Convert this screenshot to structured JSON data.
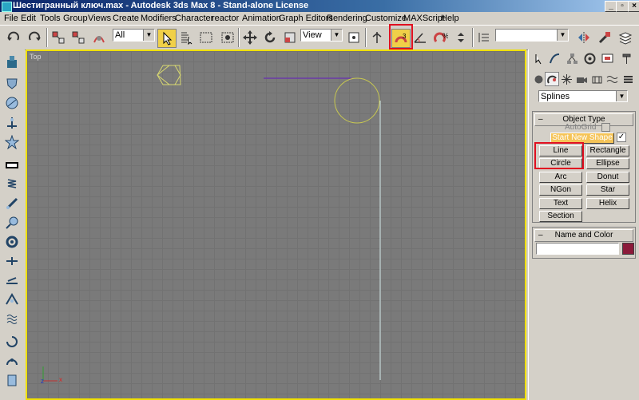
{
  "window": {
    "title": "Шестигранный ключ.max - Autodesk 3ds Max 8  - Stand-alone License",
    "min": "_",
    "max": "▫",
    "close": "×"
  },
  "menu": [
    "File",
    "Edit",
    "Tools",
    "Group",
    "Views",
    "Create",
    "Modifiers",
    "Character",
    "reactor",
    "Animation",
    "Graph Editors",
    "Rendering",
    "Customize",
    "MAXScript",
    "Help"
  ],
  "toolbar": {
    "selection_filter": "All",
    "reference_coord": "View",
    "named_selection": ""
  },
  "viewport": {
    "label": "Top",
    "axis_x": "x",
    "axis_z": "z"
  },
  "command_panel": {
    "category_dropdown": "Splines",
    "object_type": {
      "title": "Object Type",
      "autogrid_label": "AutoGrid",
      "start_new_shape_label": "Start New Shape",
      "buttons": [
        "Line",
        "Rectangle",
        "Circle",
        "Ellipse",
        "Arc",
        "Donut",
        "NGon",
        "Star",
        "Text",
        "Helix",
        "Section"
      ]
    },
    "name_and_color": {
      "title": "Name and Color",
      "name_value": "",
      "color": "#8b1a3a"
    }
  },
  "colors": {
    "viewport_border": "#f0e000",
    "highlight_red": "#e01020",
    "hexagon": "#d8d870",
    "circle": "#c8c850",
    "line_top": "#6a3aa8",
    "line_vertical": "#d8f0f0"
  },
  "icons": [
    "undo-icon",
    "redo-icon",
    "link-icon",
    "unlink-icon",
    "bind-space-warp-icon",
    "select-object-icon",
    "select-by-name-icon",
    "rectangular-selection-icon",
    "window-crossing-icon",
    "move-icon",
    "rotate-icon",
    "scale-icon",
    "pivot-icon",
    "manipulate-icon",
    "snap-3d-icon",
    "angle-snap-icon",
    "percent-snap-icon",
    "spinner-snap-icon",
    "edit-named-selection-icon",
    "mirror-icon",
    "align-icon",
    "layer-manager-icon"
  ]
}
